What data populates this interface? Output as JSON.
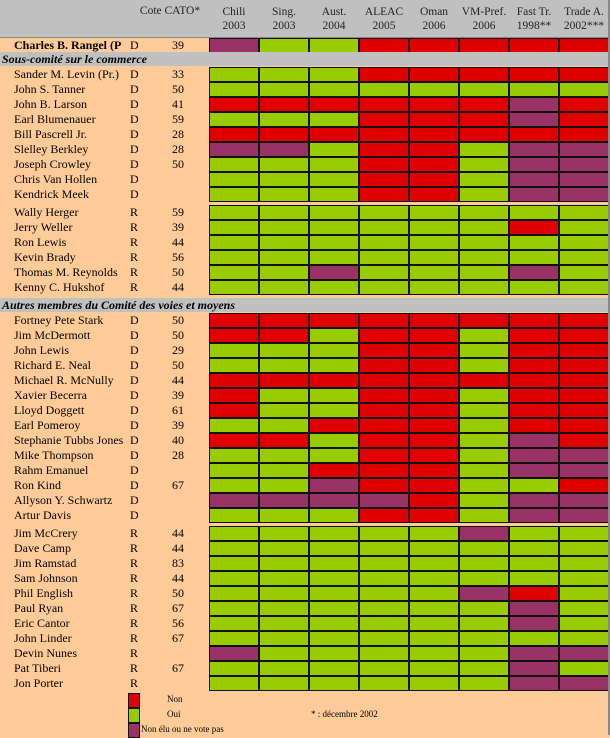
{
  "header": {
    "cato_label": "Cote CATO*",
    "columns": [
      {
        "l1": "Chili",
        "l2": "2003"
      },
      {
        "l1": "Sing.",
        "l2": "2003"
      },
      {
        "l1": "Aust.",
        "l2": "2004"
      },
      {
        "l1": "ALEAC",
        "l2": "2005"
      },
      {
        "l1": "Oman",
        "l2": "2006"
      },
      {
        "l1": "VM-Pref.",
        "l2": "2006"
      },
      {
        "l1": "Fast Tr.",
        "l2": "1998**"
      },
      {
        "l1": "Trade A.",
        "l2": "2002***"
      }
    ]
  },
  "colors": {
    "N": "#e00000",
    "O": "#99cc00",
    "X": "#993366"
  },
  "sections": {
    "trade_subcommittee": "Sous-comité sur le commerce",
    "other_members": "Autres membres du Comité des voies et moyens"
  },
  "legend": {
    "non": "Non",
    "oui": "Oui",
    "absent": "Non élu ou ne vote pas",
    "footnote": "* : décembre 2002"
  },
  "chart_data": {
    "type": "heatmap",
    "title": "",
    "columns": [
      "Chili 2003",
      "Sing. 2003",
      "Aust. 2004",
      "ALEAC 2005",
      "Oman 2006",
      "VM-Pref. 2006",
      "Fast Tr. 1998**",
      "Trade A. 2002***"
    ],
    "value_legend": {
      "N": "Non",
      "O": "Oui",
      "X": "Non élu ou ne vote pas"
    },
    "rows": [
      {
        "name": "Charles B. Rangel (Pr.)",
        "party": "D",
        "cato": "39",
        "bold": true,
        "votes": "XOONNNNN",
        "group": "chair"
      },
      {
        "name": "Sander M. Levin (Pr.)",
        "party": "D",
        "cato": "33",
        "votes": "OOONNNNN",
        "group": "sub-D"
      },
      {
        "name": "John S. Tanner",
        "party": "D",
        "cato": "50",
        "votes": "OOOOOOOO",
        "group": "sub-D"
      },
      {
        "name": "John B. Larson",
        "party": "D",
        "cato": "41",
        "votes": "NNNNNNXN",
        "group": "sub-D"
      },
      {
        "name": "Earl Blumenauer",
        "party": "D",
        "cato": "59",
        "votes": "OOONNNXN",
        "group": "sub-D"
      },
      {
        "name": "Bill Pascrell Jr.",
        "party": "D",
        "cato": "28",
        "votes": "NNNNNNNN",
        "group": "sub-D"
      },
      {
        "name": "Slelley Berkley",
        "party": "D",
        "cato": "28",
        "votes": "XXONNOXX",
        "group": "sub-D"
      },
      {
        "name": "Joseph Crowley",
        "party": "D",
        "cato": "50",
        "votes": "OOONNOXX",
        "group": "sub-D"
      },
      {
        "name": "Chris Van Hollen",
        "party": "D",
        "cato": "",
        "votes": "OOONNOXX",
        "group": "sub-D"
      },
      {
        "name": "Kendrick Meek",
        "party": "D",
        "cato": "",
        "votes": "OOONNOXX",
        "group": "sub-D"
      },
      {
        "name": "Wally Herger",
        "party": "R",
        "cato": "59",
        "votes": "OOOOOOOO",
        "group": "sub-R"
      },
      {
        "name": "Jerry Weller",
        "party": "R",
        "cato": "39",
        "votes": "OOOOOONO",
        "group": "sub-R"
      },
      {
        "name": "Ron Lewis",
        "party": "R",
        "cato": "44",
        "votes": "OOOOOOOO",
        "group": "sub-R"
      },
      {
        "name": "Kevin Brady",
        "party": "R",
        "cato": "56",
        "votes": "OOOOOOOO",
        "group": "sub-R"
      },
      {
        "name": "Thomas M. Reynolds",
        "party": "R",
        "cato": "50",
        "votes": "OOXOOOXO",
        "group": "sub-R"
      },
      {
        "name": "Kenny C. Hukshof",
        "party": "R",
        "cato": "44",
        "votes": "OOOOOOOO",
        "group": "sub-R"
      },
      {
        "name": "Fortney Pete Stark",
        "party": "D",
        "cato": "50",
        "votes": "NNNNNNNN",
        "group": "oth-D"
      },
      {
        "name": "Jim McDermott",
        "party": "D",
        "cato": "50",
        "votes": "NNONNONN",
        "group": "oth-D"
      },
      {
        "name": "John Lewis",
        "party": "D",
        "cato": "29",
        "votes": "OOONNONN",
        "group": "oth-D"
      },
      {
        "name": "Richard E. Neal",
        "party": "D",
        "cato": "50",
        "votes": "OOONNONN",
        "group": "oth-D"
      },
      {
        "name": "Michael R. McNully",
        "party": "D",
        "cato": "44",
        "votes": "NNNNNNNN",
        "group": "oth-D"
      },
      {
        "name": "Xavier Becerra",
        "party": "D",
        "cato": "39",
        "votes": "NOONNONN",
        "group": "oth-D"
      },
      {
        "name": "Lloyd Doggett",
        "party": "D",
        "cato": "61",
        "votes": "NOONNONN",
        "group": "oth-D"
      },
      {
        "name": "Earl Pomeroy",
        "party": "D",
        "cato": "39",
        "votes": "OONNNONN",
        "group": "oth-D"
      },
      {
        "name": "Stephanie Tubbs Jones",
        "party": "D",
        "cato": "40",
        "votes": "NNONNOXN",
        "group": "oth-D"
      },
      {
        "name": "Mike Thompson",
        "party": "D",
        "cato": "28",
        "votes": "OOONNOXX",
        "group": "oth-D"
      },
      {
        "name": "Rahm Emanuel",
        "party": "D",
        "cato": "",
        "votes": "OONNNOXX",
        "group": "oth-D"
      },
      {
        "name": "Ron Kind",
        "party": "D",
        "cato": "67",
        "votes": "OOXNNOON",
        "group": "oth-D"
      },
      {
        "name": "Allyson Y. Schwartz",
        "party": "D",
        "cato": "",
        "votes": "XXXXNOXX",
        "group": "oth-D"
      },
      {
        "name": "Artur Davis",
        "party": "D",
        "cato": "",
        "votes": "OOONNOXX",
        "group": "oth-D"
      },
      {
        "name": "Jim McCrery",
        "party": "R",
        "cato": "44",
        "votes": "OOOOOXOO",
        "group": "oth-R"
      },
      {
        "name": "Dave Camp",
        "party": "R",
        "cato": "44",
        "votes": "OOOOOOOO",
        "group": "oth-R"
      },
      {
        "name": "Jim Ramstad",
        "party": "R",
        "cato": "83",
        "votes": "OOOOOOOO",
        "group": "oth-R"
      },
      {
        "name": "Sam Johnson",
        "party": "R",
        "cato": "44",
        "votes": "OOOOOOOO",
        "group": "oth-R"
      },
      {
        "name": "Phil English",
        "party": "R",
        "cato": "50",
        "votes": "OOOOOXNO",
        "group": "oth-R"
      },
      {
        "name": "Paul Ryan",
        "party": "R",
        "cato": "67",
        "votes": "OOOOOOXO",
        "group": "oth-R"
      },
      {
        "name": "Eric Cantor",
        "party": "R",
        "cato": "56",
        "votes": "OOOOOOXO",
        "group": "oth-R"
      },
      {
        "name": "John Linder",
        "party": "R",
        "cato": "67",
        "votes": "OOOOOOOO",
        "group": "oth-R"
      },
      {
        "name": "Devin Nunes",
        "party": "R",
        "cato": "",
        "votes": "XOOOOOXX",
        "group": "oth-R"
      },
      {
        "name": "Pat Tiberi",
        "party": "R",
        "cato": "67",
        "votes": "OOOOOOXO",
        "group": "oth-R"
      },
      {
        "name": "Jon Porter",
        "party": "R",
        "cato": "",
        "votes": "OOOOOOXX",
        "group": "oth-R"
      }
    ]
  }
}
